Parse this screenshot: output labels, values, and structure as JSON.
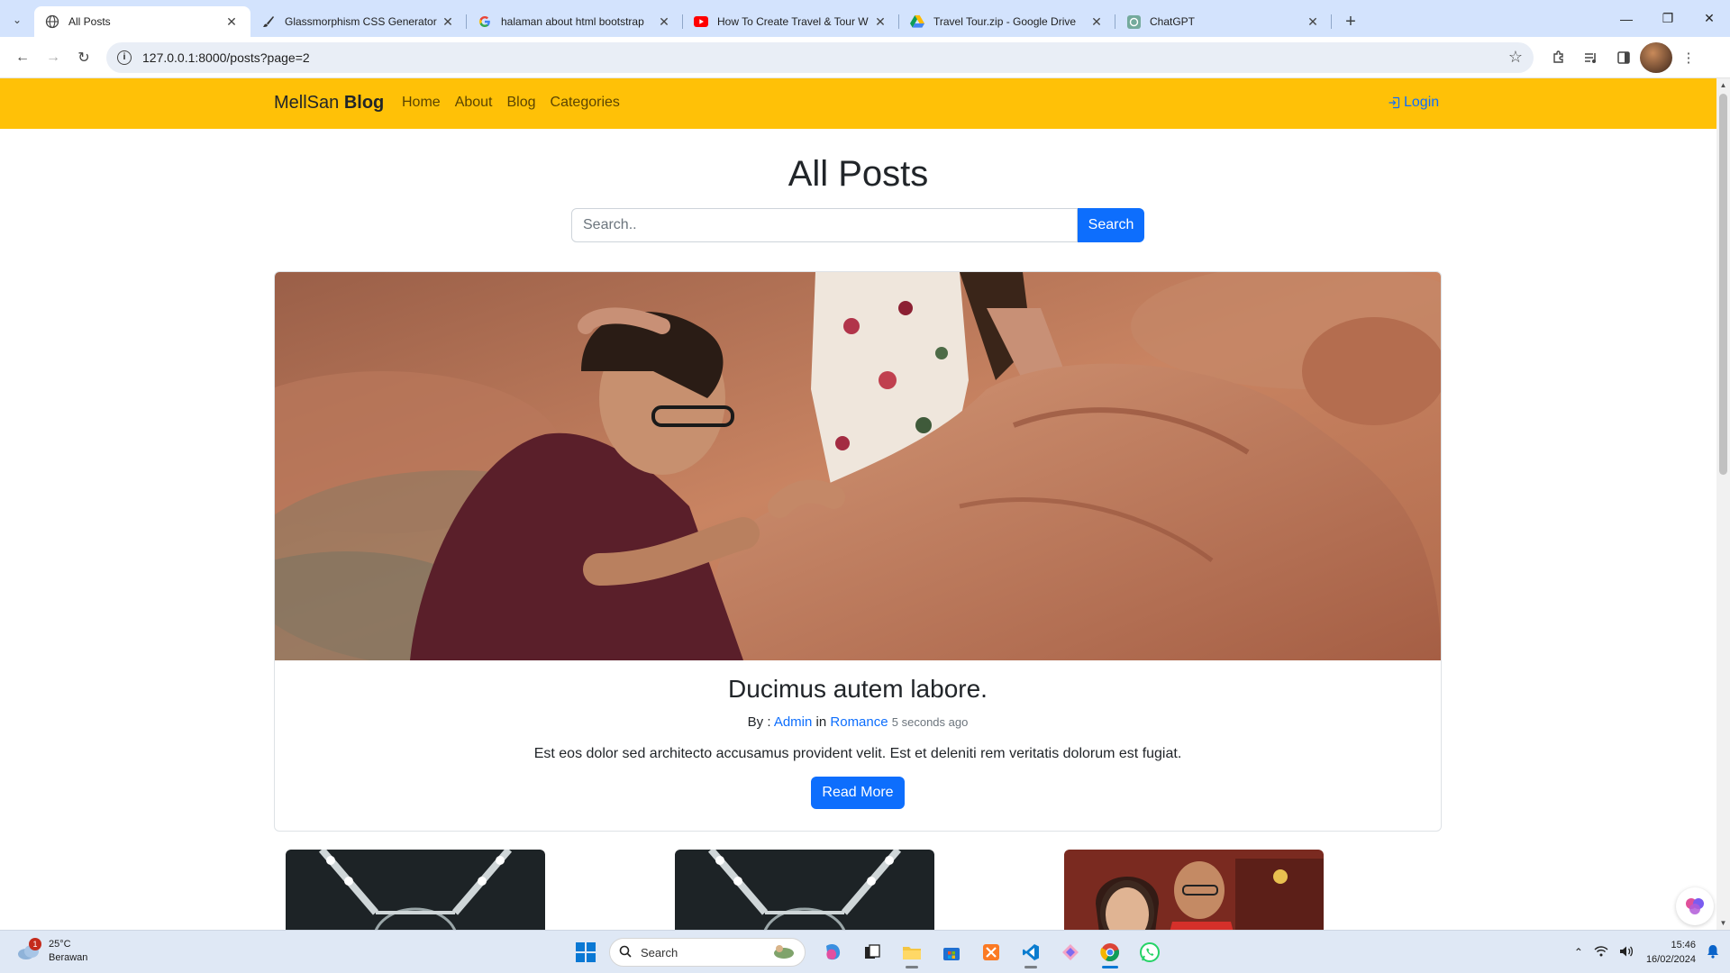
{
  "browser": {
    "tabs": [
      {
        "title": "All Posts",
        "icon": "globe-icon",
        "active": true
      },
      {
        "title": "Glassmorphism CSS Generator",
        "icon": "brush-icon",
        "active": false
      },
      {
        "title": "halaman about html bootstrap",
        "icon": "google-icon",
        "active": false
      },
      {
        "title": "How To Create Travel & Tour W",
        "icon": "youtube-icon",
        "active": false
      },
      {
        "title": "Travel Tour.zip - Google Drive",
        "icon": "drive-icon",
        "active": false
      },
      {
        "title": "ChatGPT",
        "icon": "chatgpt-icon",
        "active": false
      }
    ],
    "url": "127.0.0.1:8000/posts?page=2"
  },
  "site": {
    "brand_light": "MellSan",
    "brand_bold": "Blog",
    "nav": [
      {
        "label": "Home"
      },
      {
        "label": "About"
      },
      {
        "label": "Blog"
      },
      {
        "label": "Categories"
      }
    ],
    "login_label": "Login",
    "accent_color": "#ffc107"
  },
  "main": {
    "title": "All Posts",
    "search": {
      "placeholder": "Search..",
      "value": "",
      "button": "Search"
    },
    "featured": {
      "title": "Ducimus autem labore.",
      "by_label": "By :",
      "author": "Admin",
      "in_label": "in",
      "category": "Romance",
      "time": "5 seconds ago",
      "excerpt": "Est eos dolor sed architecto accusamus provident velit. Est et deleniti rem veritatis dolorum est fugiat.",
      "button": "Read More"
    }
  },
  "taskbar": {
    "weather_temp": "25°C",
    "weather_desc": "Berawan",
    "weather_badge": "1",
    "search_label": "Search",
    "time": "15:46",
    "date": "16/02/2024"
  }
}
